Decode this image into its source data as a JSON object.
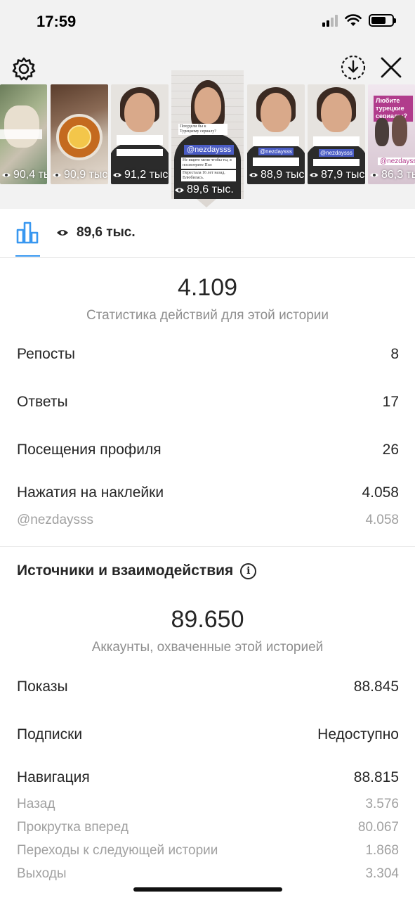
{
  "status_bar": {
    "time": "17:59"
  },
  "header": {
    "settings_icon": "gear-icon",
    "download_all_icon": "download-circle-icon",
    "close_icon": "close-icon"
  },
  "stories": {
    "thumbnails": [
      {
        "views": "90,4 тыс",
        "scene": "dough-on-blanket"
      },
      {
        "views": "90,9 тыс",
        "scene": "tea-with-lemon"
      },
      {
        "views": "91,2 тыс",
        "scene": "woman-talking"
      },
      {
        "views": "88,9 тыс",
        "scene": "woman-talking"
      },
      {
        "views": "87,9 тыс",
        "scene": "woman-talking"
      },
      {
        "views": "86,3 тыс",
        "scene": "turkish-series-poster"
      }
    ],
    "active": {
      "views": "89,6 тыс.",
      "caption_top": "Похудели бы к Турецкому сериалу?",
      "mention": "@nezdaysss",
      "caption_mid": "Не ищите меня чтобы ты, я посмотрите Пол",
      "caption_bottom": "Перестала 16 лет назад. Влюбилась."
    },
    "thumb_captions": {
      "tag": "@nezdaysss",
      "poster_title": "Любите турецкие сериалы?",
      "poster_tag": "@nezdaysss"
    }
  },
  "toolbar": {
    "views": "89,6 тыс.",
    "icons": [
      "bar-chart-icon",
      "eye-icon",
      "trending-icon",
      "download-icon",
      "share-icon",
      "trash-icon"
    ]
  },
  "interactions": {
    "total": "4.109",
    "caption": "Статистика действий для этой истории",
    "rows": [
      {
        "label": "Репосты",
        "value": "8"
      },
      {
        "label": "Ответы",
        "value": "17"
      },
      {
        "label": "Посещения профиля",
        "value": "26"
      },
      {
        "label": "Нажатия на наклейки",
        "value": "4.058"
      }
    ],
    "sticker": {
      "label": "@nezdaysss",
      "value": "4.058"
    }
  },
  "discovery": {
    "title": "Источники и взаимодействия",
    "total": "89.650",
    "caption": "Аккаунты, охваченные этой историей",
    "rows": [
      {
        "label": "Показы",
        "value": "88.845"
      },
      {
        "label": "Подписки",
        "value": "Недоступно"
      },
      {
        "label": "Навигация",
        "value": "88.815"
      }
    ],
    "navigation": [
      {
        "label": "Назад",
        "value": "3.576"
      },
      {
        "label": "Прокрутка вперед",
        "value": "80.067"
      },
      {
        "label": "Переходы к следующей истории",
        "value": "1.868"
      },
      {
        "label": "Выходы",
        "value": "3.304"
      }
    ]
  },
  "colors": {
    "accent": "#3897f0",
    "text": "#262626",
    "secondary": "#8e8e8e"
  }
}
